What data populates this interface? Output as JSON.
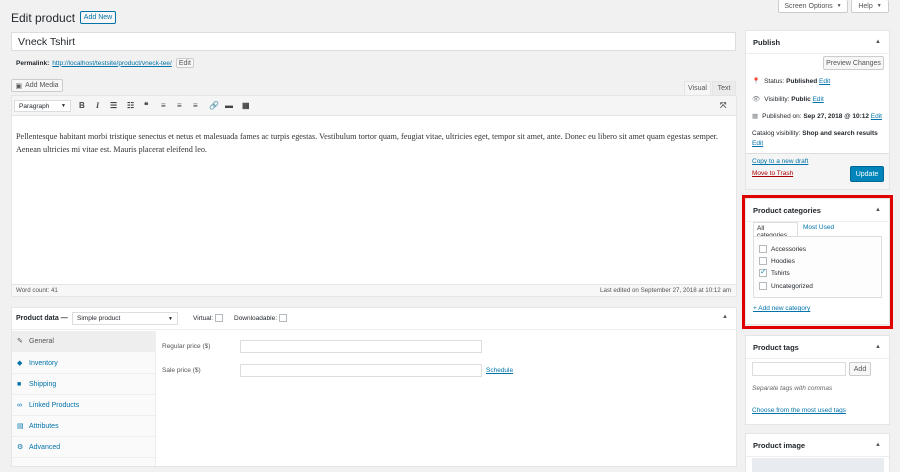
{
  "header": {
    "title": "Edit product",
    "add_new": "Add New",
    "screen_options": "Screen Options",
    "help": "Help"
  },
  "post": {
    "title_value": "Vneck Tshirt",
    "permalink_label": "Permalink:",
    "permalink_url_prefix": "http://localhost/testsite/product/",
    "permalink_slug": "vneck-tee",
    "permalink_suffix": "/",
    "edit_label": "Edit"
  },
  "editor": {
    "add_media": "Add Media",
    "tab_visual": "Visual",
    "tab_text": "Text",
    "format_select": "Paragraph",
    "content": "Pellentesque habitant morbi tristique senectus et netus et malesuada fames ac turpis egestas. Vestibulum tortor quam, feugiat vitae, ultricies eget, tempor sit amet, ante. Donec eu libero sit amet quam egestas semper. Aenean ultricies mi vitae est. Mauris placerat eleifend leo.",
    "word_count": "Word count: 41",
    "last_edited": "Last edited on September 27, 2018 at 10:12 am"
  },
  "product_data": {
    "label": "Product data —",
    "type_select": "Simple product",
    "virtual_label": "Virtual:",
    "downloadable_label": "Downloadable:",
    "tabs": [
      {
        "label": "General",
        "icon": "wrench-icon"
      },
      {
        "label": "Inventory",
        "icon": "diamond-icon"
      },
      {
        "label": "Shipping",
        "icon": "truck-icon"
      },
      {
        "label": "Linked Products",
        "icon": "link-icon"
      },
      {
        "label": "Attributes",
        "icon": "list-icon"
      },
      {
        "label": "Advanced",
        "icon": "gear-icon"
      }
    ],
    "regular_price_label": "Regular price ($)",
    "sale_price_label": "Sale price ($)",
    "schedule_label": "Schedule"
  },
  "publish": {
    "title": "Publish",
    "preview_changes": "Preview Changes",
    "status_label": "Status:",
    "status_value": "Published",
    "visibility_label": "Visibility:",
    "visibility_value": "Public",
    "published_label": "Published on:",
    "published_value": "Sep 27, 2018 @ 10:12",
    "catalog_visibility_label": "Catalog visibility:",
    "catalog_visibility_value": "Shop and search results",
    "edit": "Edit",
    "copy_draft": "Copy to a new draft",
    "trash": "Move to Trash",
    "update": "Update"
  },
  "categories": {
    "title": "Product categories",
    "tab_all": "All categories",
    "tab_most_used": "Most Used",
    "items": [
      {
        "label": "Accessories",
        "checked": false
      },
      {
        "label": "Hoodies",
        "checked": false
      },
      {
        "label": "Tshirts",
        "checked": true
      },
      {
        "label": "Uncategorized",
        "checked": false
      }
    ],
    "add_new": "+ Add new category",
    "highlight_color": "#e00000"
  },
  "tags": {
    "title": "Product tags",
    "add_button": "Add",
    "hint": "Separate tags with commas",
    "choose": "Choose from the most used tags"
  },
  "image": {
    "title": "Product image"
  },
  "colors": {
    "accent": "#0073aa",
    "update_button": "#0085ba"
  }
}
